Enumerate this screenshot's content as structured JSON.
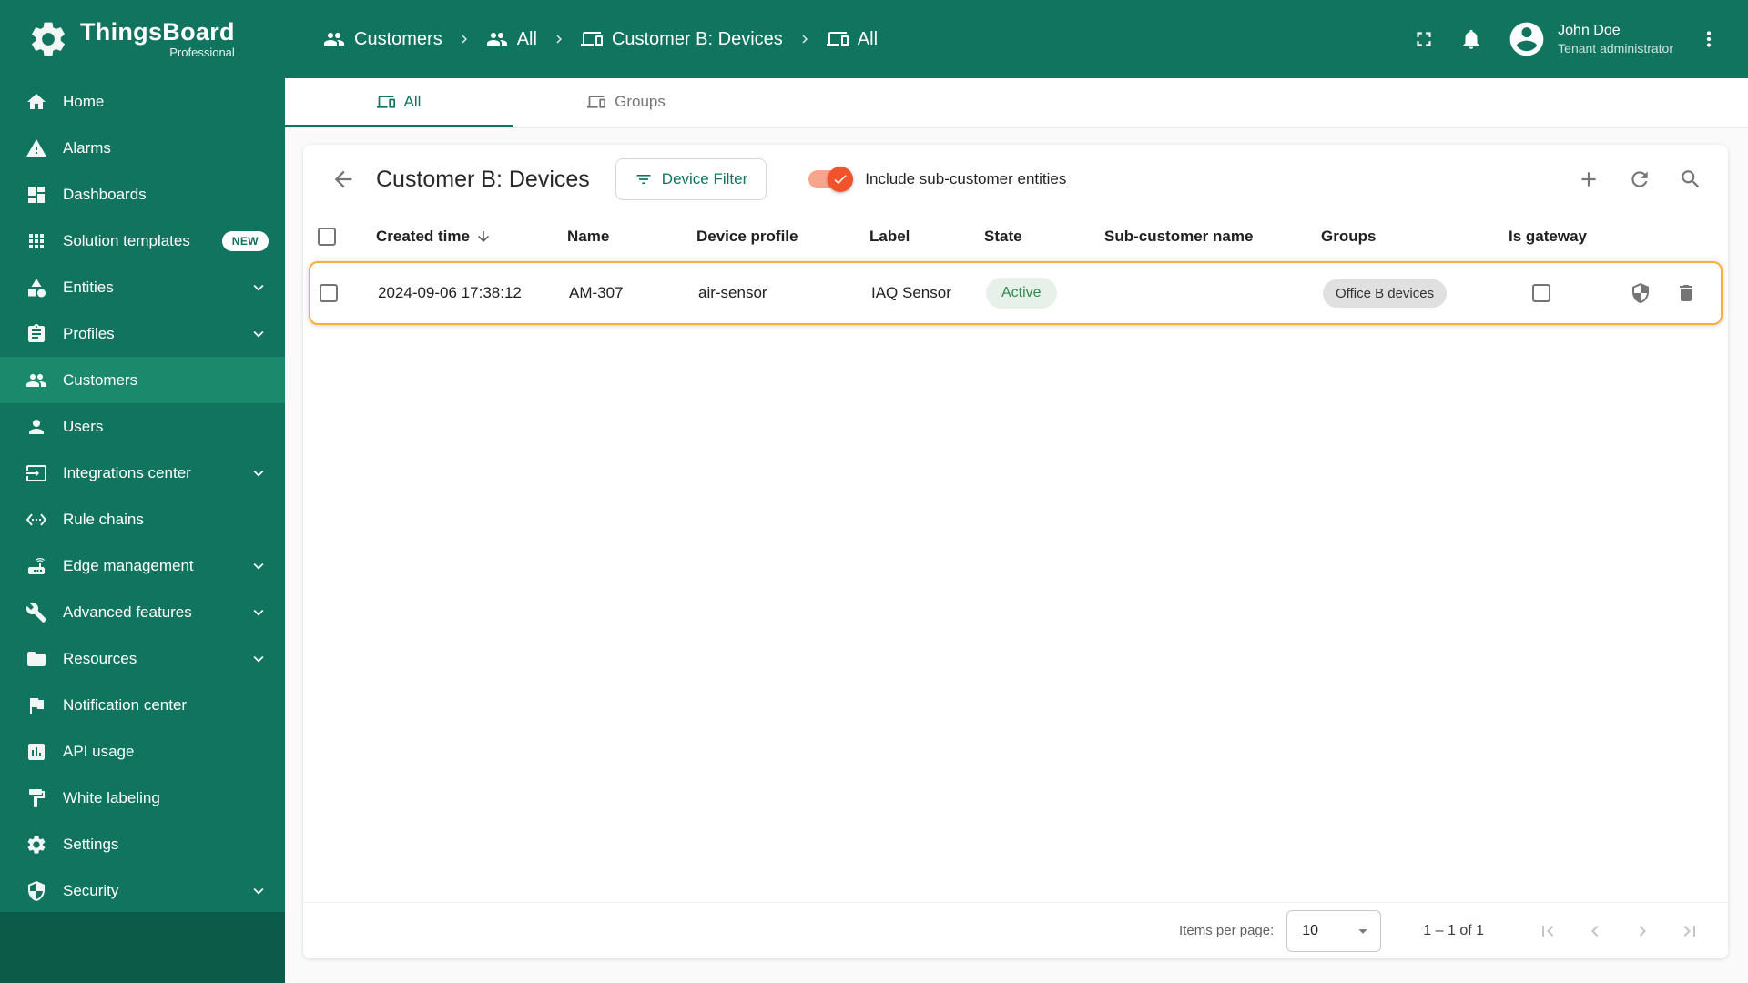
{
  "colors": {
    "primary": "#10745E",
    "sidebar_selected": "#1B8A6C",
    "accent": "#F1532C",
    "accent_track": "#F6A68C",
    "row_highlight": "#FBAE3C",
    "active_chip_bg": "#E8F0EA",
    "active_chip_text": "#2F8A4D",
    "group_chip_bg": "#E0E0E0",
    "group_chip_text": "#333333"
  },
  "app": {
    "logo_title": "ThingsBoard",
    "logo_subtitle": "Professional"
  },
  "header": {
    "breadcrumb": [
      {
        "label": "Customers",
        "icon": "customers-icon"
      },
      {
        "label": "All",
        "icon": "customers-icon"
      },
      {
        "label": "Customer B: Devices",
        "icon": "devices-icon"
      },
      {
        "label": "All",
        "icon": "devices-icon"
      }
    ],
    "user_name": "John Doe",
    "user_role": "Tenant administrator",
    "icons": [
      "fullscreen-icon",
      "bell-icon",
      "avatar",
      "more-vertical-icon"
    ]
  },
  "sidebar": {
    "items": [
      {
        "label": "Home",
        "icon": "home-icon"
      },
      {
        "label": "Alarms",
        "icon": "alarm-icon"
      },
      {
        "label": "Dashboards",
        "icon": "dashboards-icon"
      },
      {
        "label": "Solution templates",
        "icon": "solution-templates-icon",
        "badge": "NEW"
      },
      {
        "label": "Entities",
        "icon": "entities-icon",
        "expandable": true
      },
      {
        "label": "Profiles",
        "icon": "profiles-icon",
        "expandable": true
      },
      {
        "label": "Customers",
        "icon": "customers-icon",
        "selected": true
      },
      {
        "label": "Users",
        "icon": "users-icon"
      },
      {
        "label": "Integrations center",
        "icon": "integrations-icon",
        "expandable": true
      },
      {
        "label": "Rule chains",
        "icon": "rule-chains-icon"
      },
      {
        "label": "Edge management",
        "icon": "edge-management-icon",
        "expandable": true
      },
      {
        "label": "Advanced features",
        "icon": "advanced-features-icon",
        "expandable": true
      },
      {
        "label": "Resources",
        "icon": "resources-icon",
        "expandable": true
      },
      {
        "label": "Notification center",
        "icon": "notification-center-icon"
      },
      {
        "label": "API usage",
        "icon": "api-usage-icon"
      },
      {
        "label": "White labeling",
        "icon": "white-labeling-icon"
      },
      {
        "label": "Settings",
        "icon": "settings-gear-icon"
      },
      {
        "label": "Security",
        "icon": "security-shield-icon",
        "expandable": true
      }
    ]
  },
  "tabs": [
    {
      "label": "All",
      "icon": "devices-icon",
      "active": true
    },
    {
      "label": "Groups",
      "icon": "devices-icon",
      "active": false
    }
  ],
  "content": {
    "title": "Customer B: Devices",
    "device_filter_button": "Device Filter",
    "include_toggle_label": "Include sub-customer entities",
    "include_toggle_on": true,
    "toolbar_icons": [
      "add-icon",
      "refresh-icon",
      "search-icon"
    ],
    "table": {
      "columns": {
        "created_time": "Created time",
        "name": "Name",
        "device_profile": "Device profile",
        "label": "Label",
        "state": "State",
        "sub_customer": "Sub-customer name",
        "groups": "Groups",
        "is_gateway": "Is gateway"
      },
      "sort": {
        "column": "created_time",
        "direction": "desc"
      },
      "rows": [
        {
          "created_time": "2024-09-06 17:38:12",
          "name": "AM-307",
          "device_profile": "air-sensor",
          "label": "IAQ Sensor",
          "state": "Active",
          "sub_customer": "",
          "group": "Office B devices",
          "is_gateway": false,
          "highlighted": true,
          "row_icons": [
            "shield-icon",
            "trash-icon"
          ]
        }
      ]
    },
    "paginator": {
      "items_per_page_label": "Items per page:",
      "items_per_page_value": "10",
      "range": "1 – 1 of 1",
      "nav_icons": [
        "first-page-icon",
        "previous-page-icon",
        "next-page-icon",
        "last-page-icon"
      ]
    }
  }
}
